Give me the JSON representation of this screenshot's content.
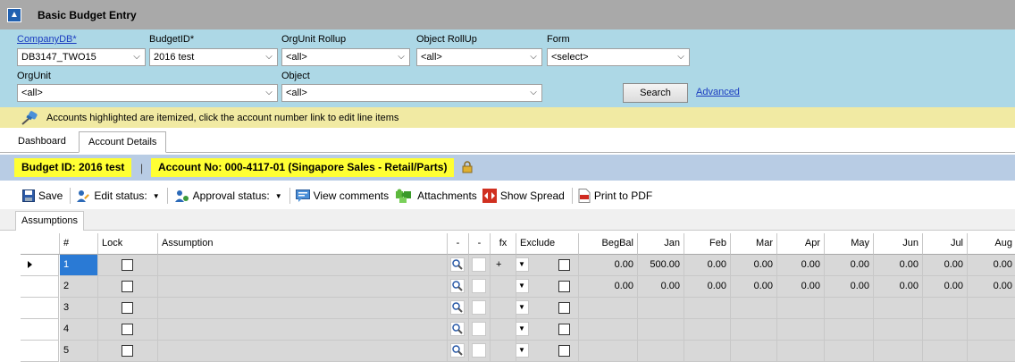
{
  "window": {
    "title": "Basic Budget Entry"
  },
  "filters": {
    "company_label": "CompanyDB*",
    "company_value": "DB3147_TWO15",
    "budget_label": "BudgetID*",
    "budget_value": "2016 test",
    "orgrollup_label": "OrgUnit Rollup",
    "orgrollup_value": "<all>",
    "objrollup_label": "Object RollUp",
    "objrollup_value": "<all>",
    "form_label": "Form",
    "form_value": "<select>",
    "orgunit_label": "OrgUnit",
    "orgunit_value": "<all>",
    "object_label": "Object",
    "object_value": "<all>",
    "search_label": "Search",
    "advanced_label": "Advanced"
  },
  "notice": {
    "text": "Accounts highlighted are itemized, click the account number link to edit line items"
  },
  "tabs": [
    {
      "label": "Dashboard"
    },
    {
      "label": "Account Details"
    }
  ],
  "banner": {
    "budget": "Budget ID: 2016 test",
    "separator": "|",
    "account": "Account No: 000-4117-01 (Singapore Sales - Retail/Parts)"
  },
  "toolbar": {
    "save": "Save",
    "edit_status": "Edit status:",
    "approval_status": "Approval status:",
    "view_comments": "View comments",
    "attachments": "Attachments",
    "show_spread": "Show Spread",
    "print_pdf": "Print to PDF"
  },
  "subtab": {
    "label": "Assumptions"
  },
  "grid": {
    "headers": [
      "#",
      "Lock",
      "Assumption",
      "-",
      "-",
      "fx",
      "Exclude",
      "BegBal",
      "Jan",
      "Feb",
      "Mar",
      "Apr",
      "May",
      "Jun",
      "Jul",
      "Aug"
    ],
    "rows": [
      {
        "num": "1",
        "fx": "+",
        "values": [
          "0.00",
          "500.00",
          "0.00",
          "0.00",
          "0.00",
          "0.00",
          "0.00",
          "0.00",
          "0.00"
        ]
      },
      {
        "num": "2",
        "fx": "",
        "values": [
          "0.00",
          "0.00",
          "0.00",
          "0.00",
          "0.00",
          "0.00",
          "0.00",
          "0.00",
          "0.00"
        ]
      },
      {
        "num": "3",
        "fx": "",
        "values": [
          "",
          "",
          "",
          "",
          "",
          "",
          "",
          "",
          ""
        ]
      },
      {
        "num": "4",
        "fx": "",
        "values": [
          "",
          "",
          "",
          "",
          "",
          "",
          "",
          "",
          ""
        ]
      },
      {
        "num": "5",
        "fx": "",
        "values": [
          "",
          "",
          "",
          "",
          "",
          "",
          "",
          "",
          ""
        ]
      }
    ]
  }
}
